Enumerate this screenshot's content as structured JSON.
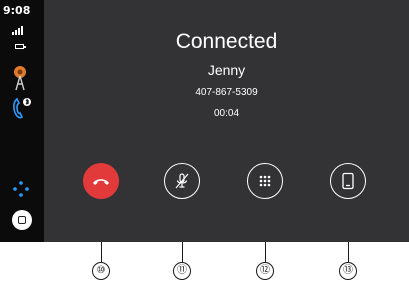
{
  "status_bar": {
    "time": "9:08"
  },
  "sidebar": {
    "icons": [
      "signal-icon",
      "battery-icon",
      "podcast-app-icon",
      "phone-app-icon",
      "app-grid-icon",
      "home-icon"
    ]
  },
  "call": {
    "status": "Connected",
    "contact_name": "Jenny",
    "phone_number": "407-867-5309",
    "duration": "00:04"
  },
  "controls": [
    {
      "id": "end-call",
      "icon": "hang-up-icon",
      "color": "#e23a3a"
    },
    {
      "id": "mute",
      "icon": "mute-microphone-icon"
    },
    {
      "id": "keypad",
      "icon": "keypad-icon"
    },
    {
      "id": "audio-source",
      "icon": "phone-handset-audio-icon"
    }
  ],
  "callouts": [
    "⑩",
    "⑪",
    "⑫",
    "⑬"
  ],
  "colors": {
    "screen_bg": "#333336",
    "sidebar_bg": "#0b0b0c",
    "accent_red": "#e23a3a"
  }
}
